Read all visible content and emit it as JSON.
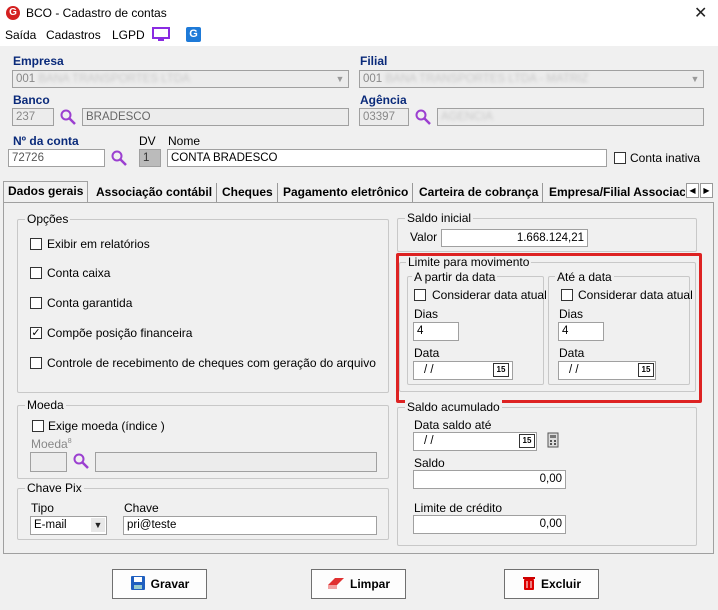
{
  "window": {
    "title": "BCO - Cadastro de contas",
    "close_label": "✕",
    "app_icon_letter": "G"
  },
  "menu": {
    "items": [
      "Saída",
      "Cadastros",
      "LGPD"
    ]
  },
  "fields": {
    "empresa": {
      "label": "Empresa",
      "value": "001",
      "blurred": "BANA TRANSPORTES LTDA"
    },
    "filial": {
      "label": "Filial",
      "value": "001",
      "blurred": "BANA TRANSPORTES LTDA - MATRIZ"
    },
    "banco": {
      "label": "Banco",
      "code": "237",
      "name": "BRADESCO"
    },
    "agencia": {
      "label": "Agência",
      "code": "03397",
      "blurred": "AGENCIA"
    },
    "conta": {
      "label": "Nº da conta",
      "value": "72726"
    },
    "dv": {
      "label": "DV",
      "value": "1"
    },
    "nome": {
      "label": "Nome",
      "value": "CONTA BRADESCO"
    },
    "conta_inativa": {
      "label": "Conta inativa",
      "checked": false
    }
  },
  "tabs": [
    "Dados gerais",
    "Associação contábil",
    "Cheques",
    "Pagamento eletrônico",
    "Carteira de cobrança",
    "Empresa/Filial Associac"
  ],
  "opcoes": {
    "title": "Opções",
    "items": [
      {
        "label": "Exibir em relatórios",
        "checked": false
      },
      {
        "label": "Conta caixa",
        "checked": false
      },
      {
        "label": "Conta garantida",
        "checked": false
      },
      {
        "label": "Compõe posição financeira",
        "checked": true
      },
      {
        "label": "Controle de recebimento de cheques com geração do arquivo",
        "checked": false
      }
    ]
  },
  "moeda": {
    "title": "Moeda",
    "exige_label": "Exige moeda (índice )",
    "moeda_label": "Moeda"
  },
  "pix": {
    "title": "Chave Pix",
    "tipo_label": "Tipo",
    "tipo_value": "E-mail",
    "chave_label": "Chave",
    "chave_value": "pri@teste"
  },
  "saldo_inicial": {
    "title": "Saldo inicial",
    "valor_label": "Valor",
    "valor": "1.668.124,21"
  },
  "limite": {
    "title": "Limite para movimento",
    "a_partir": {
      "title": "A partir da data",
      "considerar": "Considerar data atual",
      "dias_label": "Dias",
      "dias": "4",
      "data_label": "Data",
      "data": "/ /"
    },
    "ate": {
      "title": "Até a data",
      "considerar": "Considerar data atual",
      "dias_label": "Dias",
      "dias": "4",
      "data_label": "Data",
      "data": "/ /"
    }
  },
  "saldo_acumulado": {
    "title": "Saldo acumulado",
    "data_saldo_label": "Data saldo até",
    "data_saldo": "/ /",
    "saldo_label": "Saldo",
    "saldo": "0,00",
    "limite_label": "Limite de crédito",
    "limite": "0,00"
  },
  "calendar_glyph": "15",
  "buttons": {
    "gravar": "Gravar",
    "limpar": "Limpar",
    "excluir": "Excluir"
  },
  "colors": {
    "accent": "#0a2a7a",
    "highlight": "#dd2222"
  }
}
